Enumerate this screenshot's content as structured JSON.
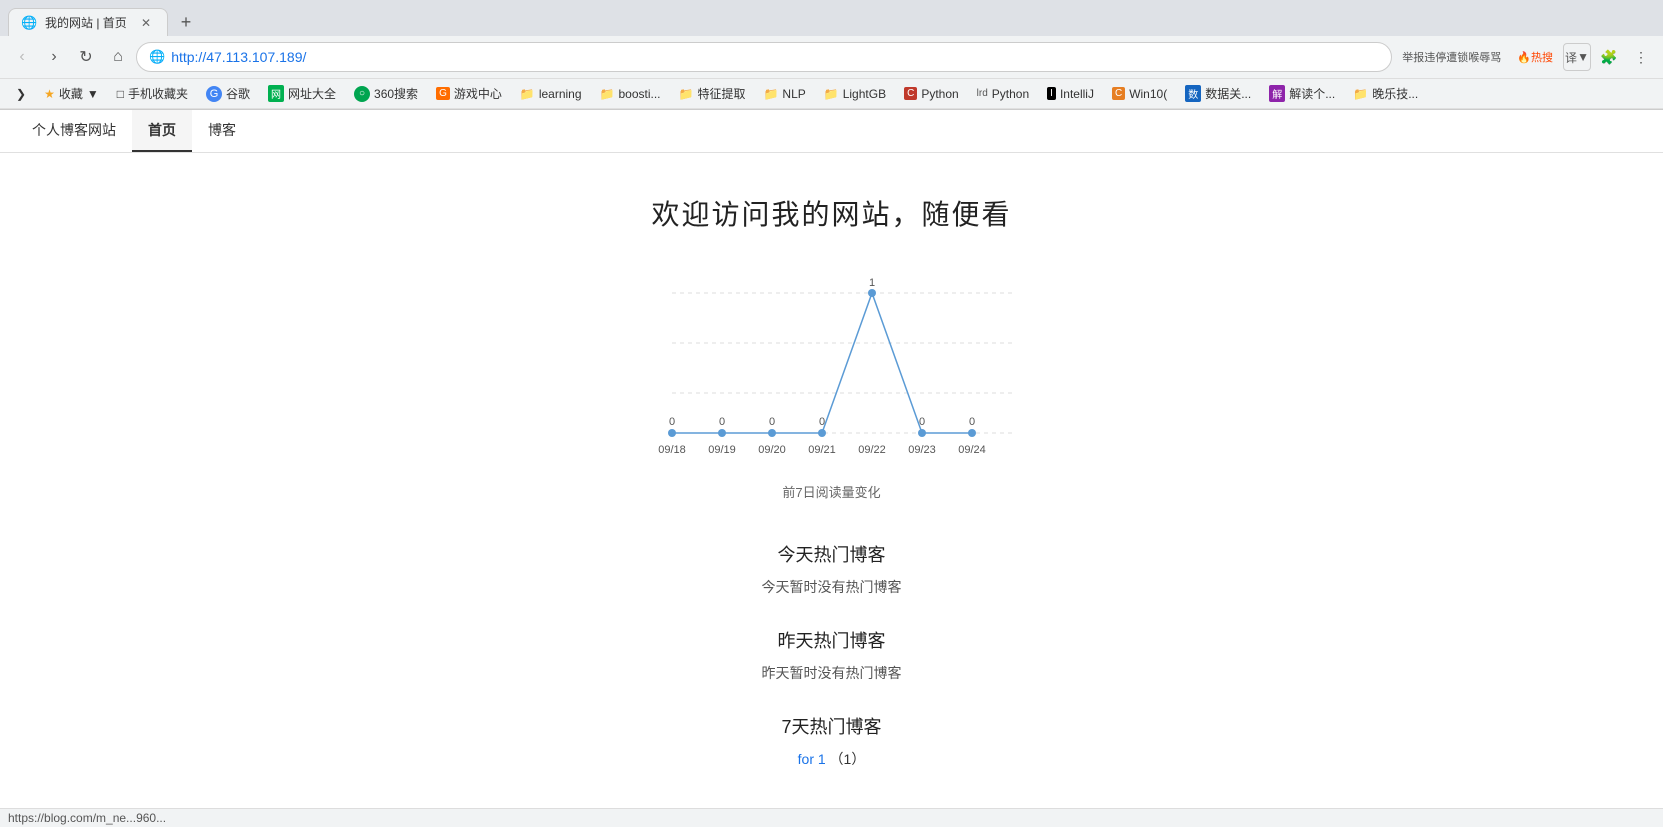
{
  "browser": {
    "tab_favicon": "🌐",
    "tab_title": "我的网站 | 首页",
    "new_tab_icon": "+",
    "back_icon": "‹",
    "forward_icon": "›",
    "reload_icon": "↻",
    "home_icon": "⌂",
    "address": "http://47.113.107.189/",
    "menu_icon": "⋮",
    "extensions_icon": "🧩",
    "report_label": "举报违停遭锁喉辱骂",
    "hot_label": "🔥热搜",
    "translate_icon": "译",
    "account_icon": "👤"
  },
  "bookmarks": [
    {
      "icon": "⭐",
      "label": "收藏",
      "type": "star"
    },
    {
      "icon": "📱",
      "label": "手机收藏夹",
      "type": "folder"
    },
    {
      "icon": "G",
      "label": "谷歌",
      "type": "blue"
    },
    {
      "icon": "网",
      "label": "网址大全",
      "type": "green"
    },
    {
      "icon": "3",
      "label": "360搜索",
      "type": "green360"
    },
    {
      "icon": "G",
      "label": "游戏中心",
      "type": "orange"
    },
    {
      "icon": "📁",
      "label": "learning",
      "type": "folder"
    },
    {
      "icon": "📁",
      "label": "boosti...",
      "type": "folder"
    },
    {
      "icon": "📁",
      "label": "特征提取",
      "type": "folder"
    },
    {
      "icon": "📁",
      "label": "NLP",
      "type": "folder"
    },
    {
      "icon": "📁",
      "label": "LightGB",
      "type": "folder"
    },
    {
      "icon": "C",
      "label": "Python",
      "type": "red"
    },
    {
      "icon": "lrd",
      "label": "Python",
      "type": "gray"
    },
    {
      "icon": "I",
      "label": "IntelliJ",
      "type": "dark"
    },
    {
      "icon": "C",
      "label": "Win10...",
      "type": "orange2"
    },
    {
      "icon": "数",
      "label": "数据关...",
      "type": "blue2"
    },
    {
      "icon": "解",
      "label": "解读个...",
      "type": "purple"
    },
    {
      "icon": "📁",
      "label": "晚乐技...",
      "type": "folder"
    }
  ],
  "site_nav": {
    "brand": "个人博客网站",
    "items": [
      {
        "label": "首页",
        "active": true
      },
      {
        "label": "博客",
        "active": false
      }
    ]
  },
  "main": {
    "welcome_text": "欢迎访问我的网站，随便看",
    "chart": {
      "label": "前7日阅读量变化",
      "dates": [
        "09/18",
        "09/19",
        "09/20",
        "09/21",
        "09/22",
        "09/23",
        "09/24"
      ],
      "values": [
        0,
        0,
        0,
        0,
        1,
        0,
        0
      ]
    },
    "sections": [
      {
        "title": "今天热门博客",
        "empty_text": "今天暂时没有热门博客"
      },
      {
        "title": "昨天热门博客",
        "empty_text": "昨天暂时没有热门博客"
      },
      {
        "title": "7天热门博客",
        "link_text": "for 1",
        "link_suffix": "（1）"
      }
    ]
  },
  "status_bar": {
    "url": "https://blog.com/m_ne...960..."
  }
}
